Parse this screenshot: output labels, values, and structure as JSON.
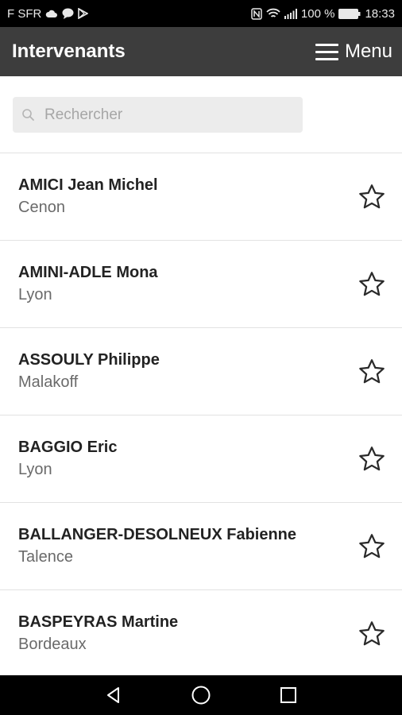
{
  "status_bar": {
    "carrier": "F SFR",
    "battery": "100 %",
    "time": "18:33",
    "left_icons": [
      "cloud-icon",
      "chat-icon",
      "play-store-icon"
    ],
    "right_icons": [
      "nfc-icon",
      "wifi-icon",
      "signal-icon",
      "battery-icon"
    ]
  },
  "header": {
    "title": "Intervenants",
    "menu_label": "Menu"
  },
  "search": {
    "placeholder": "Rechercher",
    "value": ""
  },
  "list": {
    "items": [
      {
        "name": "AMICI Jean Michel",
        "city": "Cenon"
      },
      {
        "name": "AMINI-ADLE Mona",
        "city": "Lyon"
      },
      {
        "name": "ASSOULY Philippe",
        "city": "Malakoff"
      },
      {
        "name": "BAGGIO Eric",
        "city": "Lyon"
      },
      {
        "name": "BALLANGER-DESOLNEUX Fabienne",
        "city": "Talence"
      },
      {
        "name": "BASPEYRAS Martine",
        "city": "Bordeaux"
      }
    ]
  },
  "nav": {
    "icons": [
      "back-icon",
      "home-icon",
      "recents-icon"
    ]
  },
  "colors": {
    "app_bar": "#3d3d3d",
    "status_bar": "#000000",
    "search_box": "#ececec",
    "divider": "#e2e2e2"
  }
}
